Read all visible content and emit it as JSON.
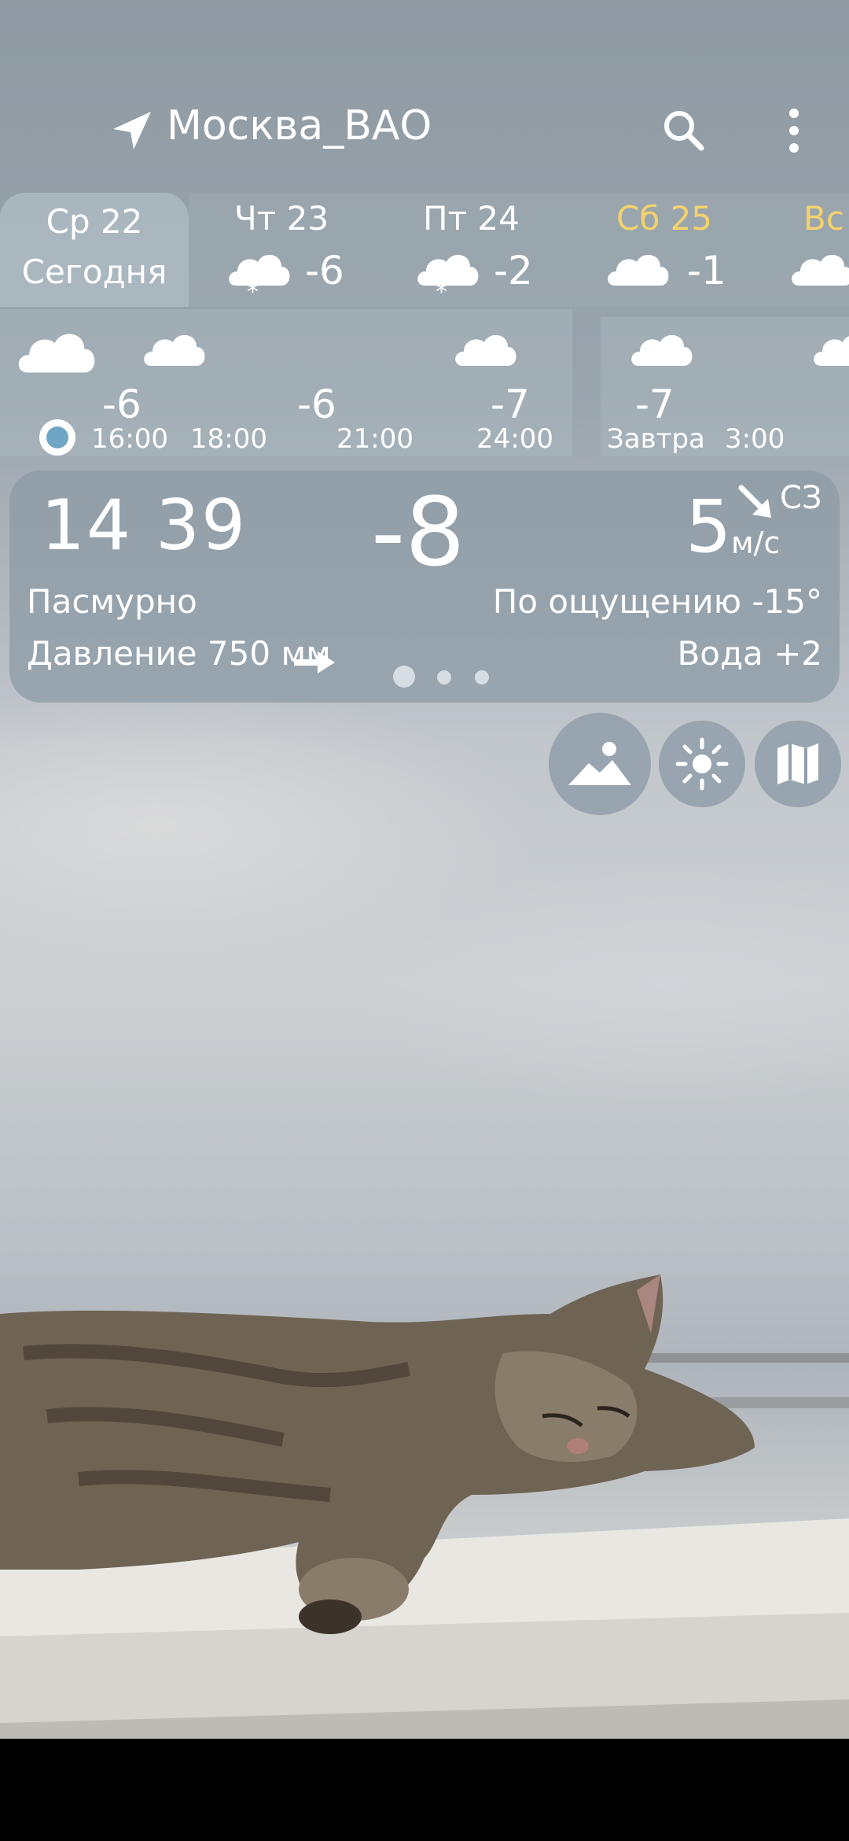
{
  "location": {
    "title": "Москва_ВАО"
  },
  "days": [
    {
      "name": "Ср 22",
      "sub": "Сегодня",
      "today": true
    },
    {
      "name": "Чт 23",
      "temp": "-6",
      "icon": "cloud-snow"
    },
    {
      "name": "Пт 24",
      "temp": "-2",
      "icon": "cloud-snow"
    },
    {
      "name": "Сб 25",
      "temp": "-1",
      "icon": "cloud",
      "color": "#f5d26b"
    },
    {
      "name": "Вс",
      "icon": "cloud",
      "color": "#f5d26b"
    }
  ],
  "hourly": {
    "temps": [
      "-6",
      "-6",
      "-7",
      "-7"
    ],
    "times": [
      "16:00",
      "18:00",
      "21:00",
      "24:00",
      "Завтра",
      "3:00"
    ]
  },
  "current": {
    "time": "14 39",
    "temp": "-8",
    "wind_speed": "5",
    "wind_dir": "СЗ",
    "wind_unit": "м/с",
    "condition": "Пасмурно",
    "feels_like": "По ощущению -15°",
    "pressure": "Давление 750 мм",
    "water": "Вода +2"
  },
  "pager": {
    "count": 3,
    "active": 0
  },
  "actions": [
    "landscape-icon",
    "sun-icon",
    "map-icon"
  ],
  "colors": {
    "weekend": "#f5d26b",
    "accent_dot": "#6fa6c5"
  }
}
